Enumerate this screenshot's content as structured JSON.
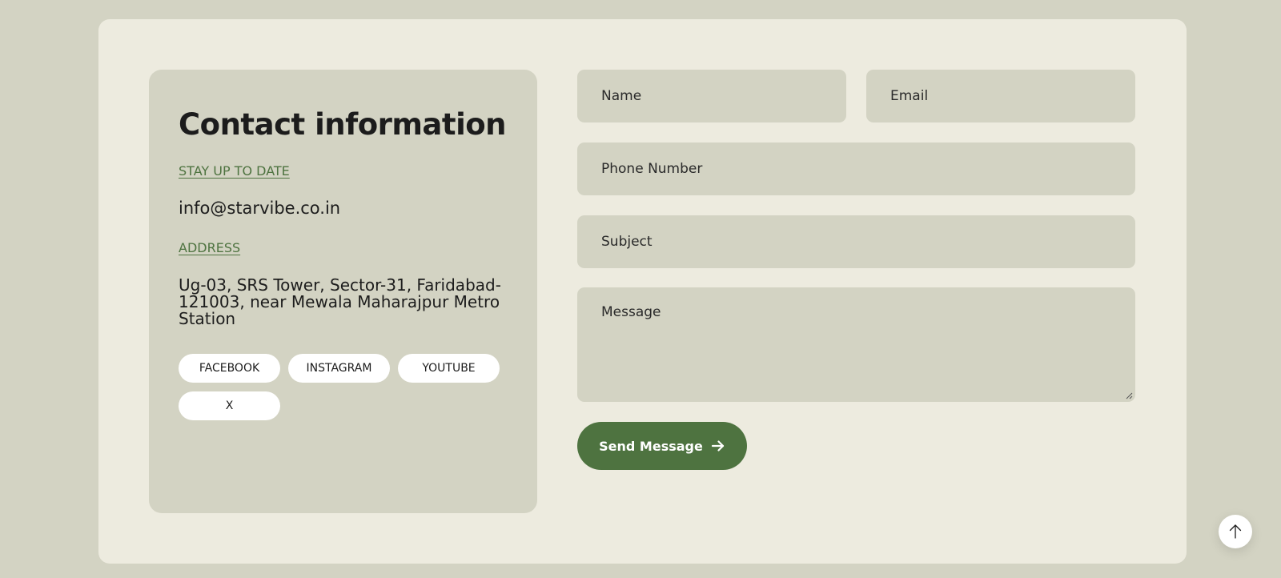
{
  "contact": {
    "title": "Contact information",
    "stay_label": "STAY UP TO DATE",
    "email": "info@starvibe.co.in",
    "address_label": "ADDRESS",
    "address": "Ug-03, SRS Tower, Sector-31, Faridabad-121003, near Mewala Maharajpur Metro Station",
    "socials": [
      "FACEBOOK",
      "INSTAGRAM",
      "YOUTUBE",
      "X"
    ]
  },
  "form": {
    "name_placeholder": "Name",
    "email_placeholder": "Email",
    "phone_placeholder": "Phone Number",
    "subject_placeholder": "Subject",
    "message_placeholder": "Message",
    "send_label": "Send Message",
    "send_icon": "arrow-right-icon"
  },
  "scroll_top_icon": "arrow-up-icon",
  "colors": {
    "page_bg": "#d3d3c3",
    "card_bg": "#edebdf",
    "accent": "#4e7340"
  }
}
